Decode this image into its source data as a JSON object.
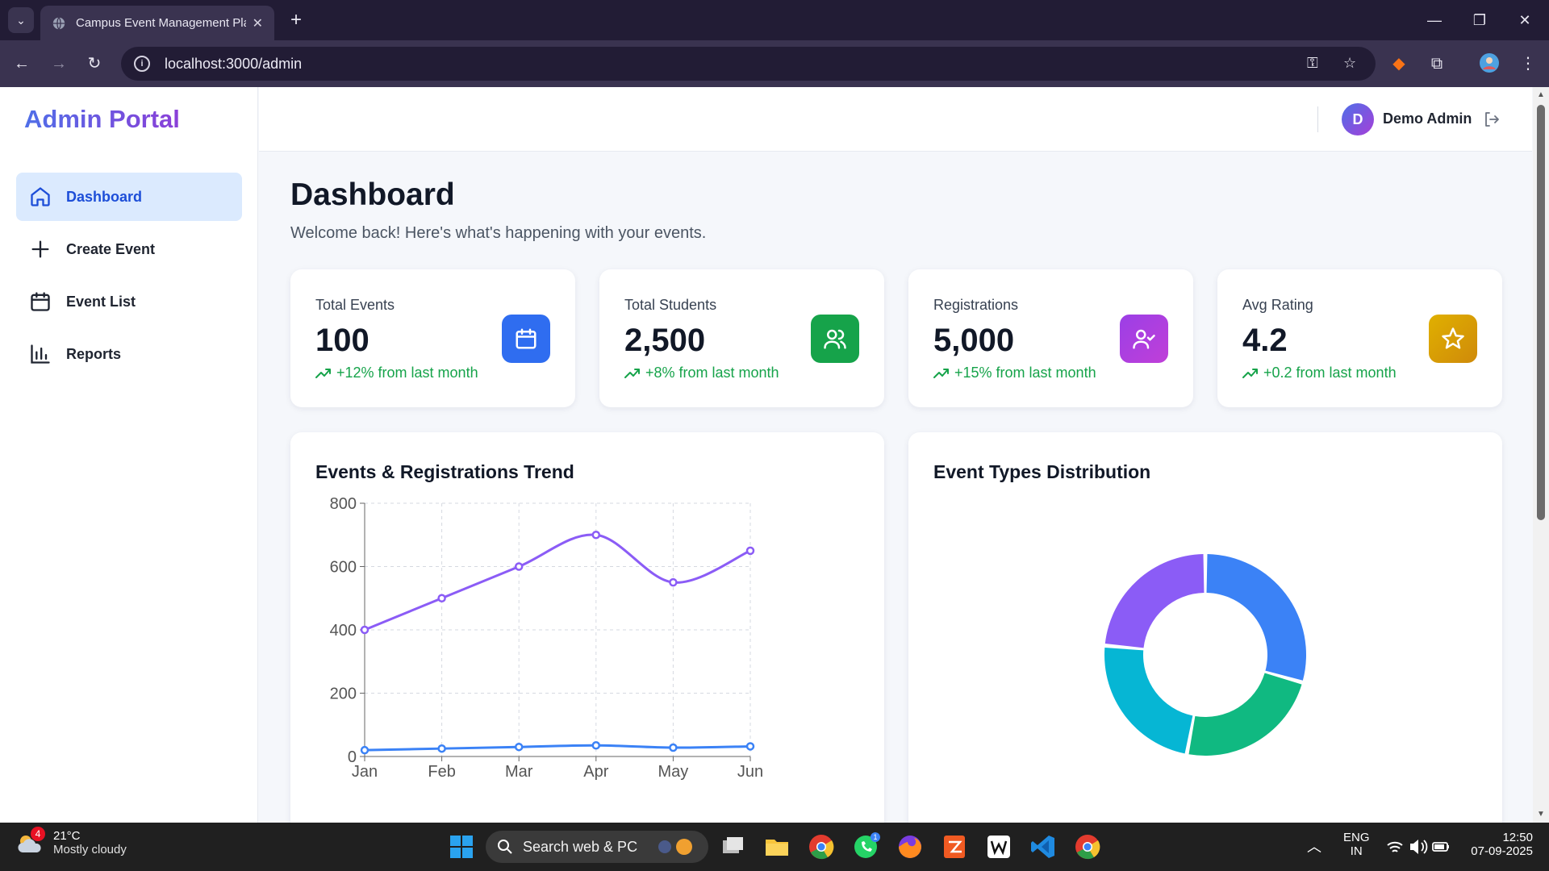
{
  "browser": {
    "tab_title": "Campus Event Management Pla",
    "url": "localhost:3000/admin"
  },
  "sidebar": {
    "brand": "Admin Portal",
    "items": [
      {
        "label": "Dashboard",
        "icon": "home-icon",
        "active": true
      },
      {
        "label": "Create Event",
        "icon": "plus-icon",
        "active": false
      },
      {
        "label": "Event List",
        "icon": "calendar-icon",
        "active": false
      },
      {
        "label": "Reports",
        "icon": "bar-chart-icon",
        "active": false
      }
    ]
  },
  "header": {
    "avatar_initial": "D",
    "username": "Demo Admin"
  },
  "main": {
    "title": "Dashboard",
    "subtitle": "Welcome back! Here's what's happening with your events.",
    "stats": [
      {
        "label": "Total Events",
        "value": "100",
        "delta": "+12% from last month",
        "icon": "calendar-icon",
        "color": "#2f6df0"
      },
      {
        "label": "Total Students",
        "value": "2,500",
        "delta": "+8% from last month",
        "icon": "users-icon",
        "color": "#16a34a"
      },
      {
        "label": "Registrations",
        "value": "5,000",
        "delta": "+15% from last month",
        "icon": "user-check-icon",
        "color": "#a33be6"
      },
      {
        "label": "Avg Rating",
        "value": "4.2",
        "delta": "+0.2 from last month",
        "icon": "star-icon",
        "color": "#d4a20c"
      }
    ],
    "trend_title": "Events & Registrations Trend",
    "dist_title": "Event Types Distribution"
  },
  "chart_data": [
    {
      "type": "line",
      "title": "Events & Registrations Trend",
      "categories": [
        "Jan",
        "Feb",
        "Mar",
        "Apr",
        "May",
        "Jun"
      ],
      "yticks": [
        "0",
        "200",
        "400",
        "600",
        "800"
      ],
      "ylim": [
        0,
        800
      ],
      "grid": true,
      "series": [
        {
          "values": [
            400,
            500,
            600,
            700,
            550,
            650
          ],
          "color": "#8b5cf6"
        },
        {
          "values": [
            20,
            25,
            30,
            35,
            28,
            32
          ],
          "color": "#3b82f6"
        }
      ]
    },
    {
      "type": "pie",
      "title": "Event Types Distribution",
      "donut": true,
      "values": [
        25,
        20,
        20,
        20
      ],
      "colors": [
        "#3b82f6",
        "#10b981",
        "#06b6d4",
        "#8b5cf6"
      ]
    }
  ],
  "taskbar": {
    "temperature": "21°C",
    "weather": "Mostly cloudy",
    "weather_badge": "4",
    "search_placeholder": "Search web & PC",
    "lang_1": "ENG",
    "lang_2": "IN",
    "time": "12:50",
    "date": "07-09-2025",
    "whatsapp_badge": "1"
  }
}
